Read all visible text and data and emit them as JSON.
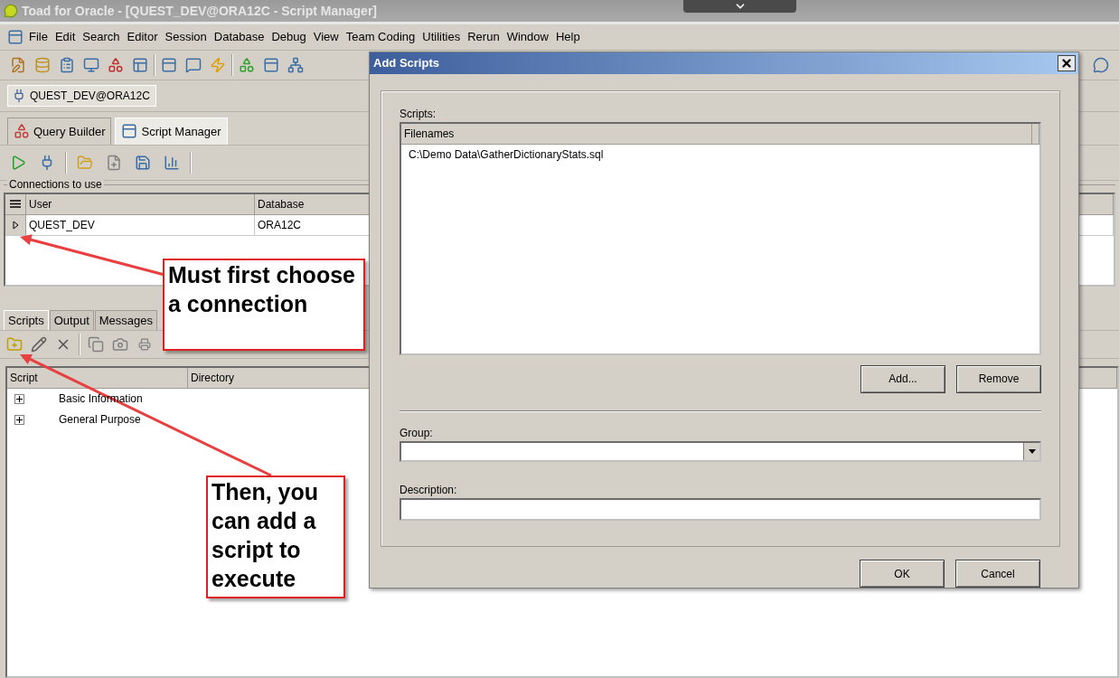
{
  "window": {
    "title": "Toad for Oracle - [QUEST_DEV@ORA12C - Script Manager]"
  },
  "menu": [
    "File",
    "Edit",
    "Search",
    "Editor",
    "Session",
    "Database",
    "Debug",
    "View",
    "Team Coding",
    "Utilities",
    "Rerun",
    "Window",
    "Help"
  ],
  "connection_tab": {
    "label": "QUEST_DEV@ORA12C"
  },
  "module_tabs": [
    {
      "label": "Query Builder",
      "selected": false
    },
    {
      "label": "Script Manager",
      "selected": true
    }
  ],
  "connections": {
    "title": "Connections to use",
    "columns": [
      "User",
      "Database"
    ],
    "rows": [
      {
        "user": "QUEST_DEV",
        "database": "ORA12C",
        "selected": true
      }
    ]
  },
  "bottom_tabs": [
    {
      "label": "Scripts",
      "selected": true
    },
    {
      "label": "Output",
      "selected": false
    },
    {
      "label": "Messages",
      "selected": false
    }
  ],
  "scripts_tree": {
    "columns": [
      "Script",
      "Directory"
    ],
    "items": [
      {
        "label": "Basic Information",
        "expanded": false
      },
      {
        "label": "General Purpose",
        "expanded": false
      }
    ]
  },
  "dialog": {
    "title": "Add Scripts",
    "scripts_label": "Scripts:",
    "list_column": "Filenames",
    "files": [
      "C:\\Demo Data\\GatherDictionaryStats.sql"
    ],
    "add_button": "Add...",
    "remove_button": "Remove",
    "group_label": "Group:",
    "description_label": "Description:",
    "ok_button": "OK",
    "cancel_button": "Cancel"
  },
  "callouts": [
    {
      "text": "Must first choose a connection"
    },
    {
      "text": "Then, you can add a script to execute"
    }
  ]
}
